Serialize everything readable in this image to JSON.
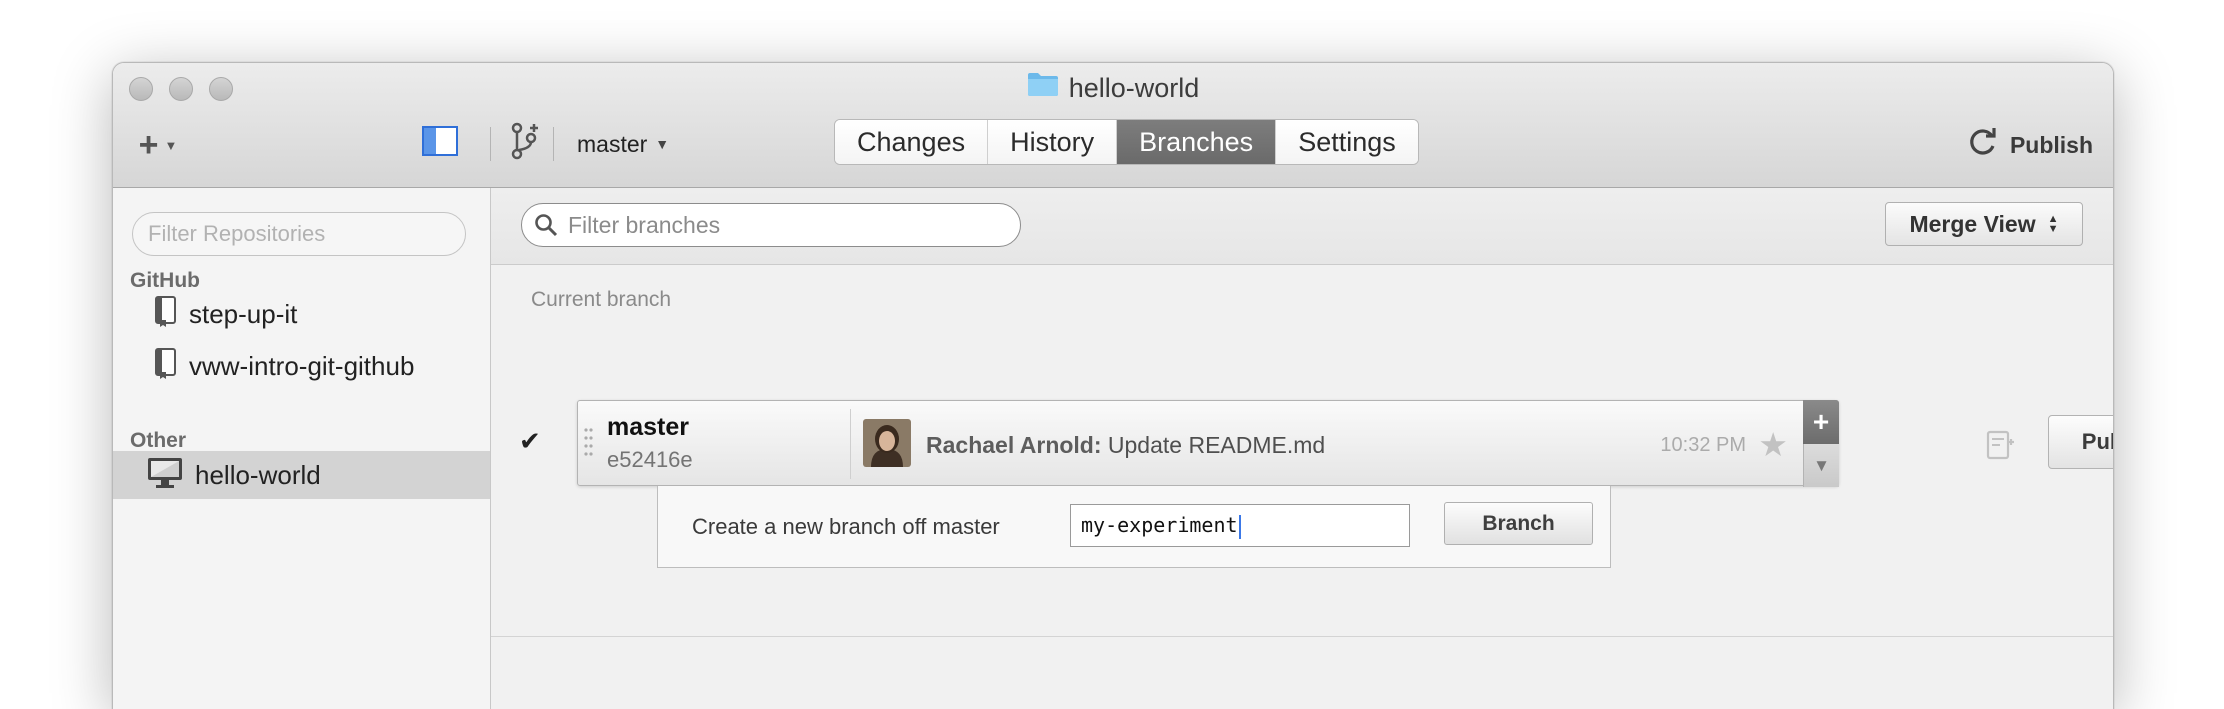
{
  "window": {
    "title": "hello-world"
  },
  "toolbar": {
    "current_branch": "master",
    "tabs": [
      {
        "label": "Changes",
        "active": false
      },
      {
        "label": "History",
        "active": false
      },
      {
        "label": "Branches",
        "active": true
      },
      {
        "label": "Settings",
        "active": false
      }
    ],
    "publish_label": "Publish"
  },
  "sidebar": {
    "search_placeholder": "Filter Repositories",
    "groups": [
      {
        "label": "GitHub",
        "repos": [
          {
            "name": "step-up-it"
          },
          {
            "name": "vww-intro-git-github"
          }
        ]
      },
      {
        "label": "Other",
        "repos": [
          {
            "name": "hello-world",
            "selected": true
          }
        ]
      }
    ]
  },
  "branches": {
    "filter_placeholder": "Filter branches",
    "merge_view_label": "Merge View",
    "current_branch_label": "Current branch",
    "current": {
      "name": "master",
      "sha": "e52416e",
      "author": "Rachael Arnold:",
      "message": "Update README.md",
      "time": "10:32 PM"
    },
    "publish_label": "Publish",
    "create": {
      "label": "Create a new branch off master",
      "input_value": "my-experiment",
      "button_label": "Branch"
    }
  },
  "colors": {
    "active_tab": "#6f6f6f",
    "selection": "#d3d3d3",
    "caret": "#3b78e7"
  }
}
